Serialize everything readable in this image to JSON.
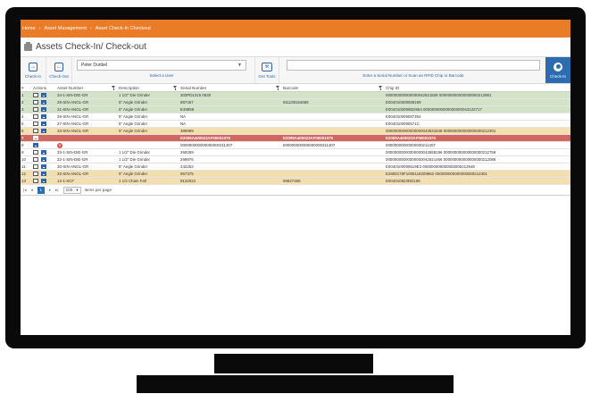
{
  "breadcrumb": [
    "Home",
    "Asset Management",
    "Asset Check-In Checkout"
  ],
  "page": {
    "title": "Assets Check-In/ Check-out"
  },
  "toolbar": {
    "check_in_label": "Check-In",
    "check_out_label": "Check-Out",
    "user_value": "Peter Dunbel",
    "user_hint": "Select a User",
    "get_tools_label": "Get Tools",
    "scan_hint": "Enter a Serial Number or Scan an RFID Chip or Barcode",
    "check_in_submit_label": "Check-In"
  },
  "table": {
    "headers": [
      "#",
      "Actions",
      "Asset Number",
      "Description",
      "Serial Number",
      "Barcode",
      "Chip ID"
    ],
    "rows": [
      {
        "n": "1",
        "asset": "34-1-SIN-DIE-GR",
        "desc": "1 1/2\" Die Grinder",
        "serial": "303PD1315 0630",
        "barcode": "",
        "chip": "000000000000000042621828 000000000000000000212881",
        "status": "green"
      },
      {
        "n": "2",
        "asset": "29-SIN-ANGL-GR",
        "desc": "5\" Angle Grinder",
        "serial": "897467",
        "barcode": "911108154685",
        "chip": "E004010009058199",
        "status": "green"
      },
      {
        "n": "3",
        "asset": "31-SIN-ANGL-GR",
        "desc": "5\" Angle Grinder",
        "serial": "E49959",
        "barcode": "",
        "chip": "E0040100090ED664 000000000000000000043122717",
        "status": "green"
      },
      {
        "n": "4",
        "asset": "26-SIN-ANGL-GR",
        "desc": "5\" Angle Grinder",
        "serial": "NA",
        "barcode": "",
        "chip": "E004010009087264",
        "status": ""
      },
      {
        "n": "5",
        "asset": "27-SIN-ANGL-GR",
        "desc": "5\" Angle Grinder",
        "serial": "NA",
        "barcode": "",
        "chip": "E0040100090571C",
        "status": ""
      },
      {
        "n": "6",
        "asset": "33-SIN-ANGL-GR",
        "desc": "5\" Angle Grinder",
        "serial": "389999",
        "barcode": "",
        "chip": "00000000000000000043531848 000000000000000000212301",
        "status": "yellow"
      },
      {
        "n": "7",
        "asset": "",
        "desc": "",
        "serial": "E2009A400023AF00001075",
        "barcode": "E2009A400023AF00001075",
        "chip": "E2009A400023AF00001075",
        "status": "red"
      },
      {
        "n": "8",
        "asset": "",
        "desc": "",
        "serial": "000000000000000000211307",
        "barcode": "000000000000000000211307",
        "chip": "00000000000000000211307",
        "status": "new"
      },
      {
        "n": "9",
        "asset": "33-1-SIN-DIE-GR",
        "desc": "1 1/2\" Die Grinder",
        "serial": "268269",
        "barcode": "",
        "chip": "00000000000000000043558196 000000000000000000212758",
        "status": ""
      },
      {
        "n": "10",
        "asset": "32-1-SIN-DIE-GR",
        "desc": "1 1/2\" Die Grinder",
        "serial": "269976",
        "barcode": "",
        "chip": "00000000000000000042621466 000000000000000000212088",
        "status": ""
      },
      {
        "n": "11",
        "asset": "30-SIN-ANGL-GR",
        "desc": "5\" Angle Grinder",
        "serial": "242253",
        "barcode": "",
        "chip": "E0040100090619E3 000000000000000000212948",
        "status": ""
      },
      {
        "n": "12",
        "asset": "32-SIN-ANGL-GR",
        "desc": "5\" Angle Grinder",
        "serial": "957375",
        "barcode": "",
        "chip": "E2808176F1005118209852 000000000000000000212301",
        "status": "yellow"
      },
      {
        "n": "13",
        "asset": "12-1-SCF",
        "desc": "1 1/2 Chain Fall",
        "serial": "9132024",
        "barcode": "96827465",
        "chip": "E004010823DD169",
        "status": "yellow"
      }
    ]
  },
  "pager": {
    "current_page": "1",
    "page_size": "100",
    "items_per_page_label": "items per page"
  }
}
